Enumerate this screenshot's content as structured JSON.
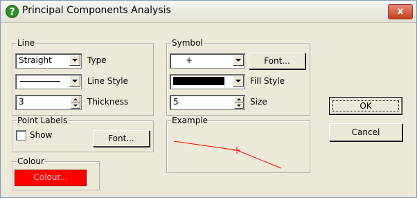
{
  "window": {
    "title": "Principal Components Analysis",
    "close_label": "x"
  },
  "line_group": {
    "legend": "Line",
    "type_value": "Straight",
    "type_label": "Type",
    "line_style_label": "Line Style",
    "thickness_value": "3",
    "thickness_label": "Thickness"
  },
  "symbol_group": {
    "legend": "Symbol",
    "symbol_value": "+",
    "font_button": "Font...",
    "fill_style_label": "Fill Style",
    "size_value": "5",
    "size_label": "Size"
  },
  "point_labels_group": {
    "legend": "Point Labels",
    "show_label": "Show",
    "show_checked": false,
    "font_button": "Font..."
  },
  "example_group": {
    "legend": "Example",
    "line_color": "#ff0000"
  },
  "colour_group": {
    "legend": "Colour",
    "colour_button": "Colour...",
    "colour_value": "#ff0000"
  },
  "buttons": {
    "ok": "OK",
    "cancel": "Cancel"
  }
}
